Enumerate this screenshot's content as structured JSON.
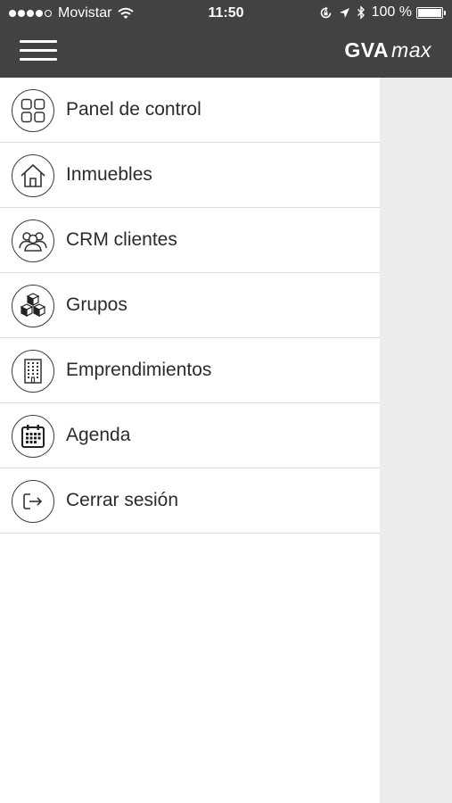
{
  "status_bar": {
    "carrier": "Movistar",
    "signal_bars_filled": 4,
    "signal_bars_total": 5,
    "time": "11:50",
    "battery_text": "100 %",
    "battery_level": 1.0,
    "icons": [
      "signal-dots-icon",
      "wifi-icon",
      "orientation-lock-icon",
      "location-arrow-icon",
      "bluetooth-icon",
      "battery-icon"
    ]
  },
  "header": {
    "logo_bold": "GVA",
    "logo_italic": "max",
    "menu_icon": "hamburger-menu-icon",
    "background": "#424242"
  },
  "menu": {
    "items": [
      {
        "label": "Panel de control",
        "icon": "dashboard-grid-icon"
      },
      {
        "label": "Inmuebles",
        "icon": "house-icon"
      },
      {
        "label": "CRM clientes",
        "icon": "people-group-icon"
      },
      {
        "label": "Grupos",
        "icon": "cubes-icon"
      },
      {
        "label": "Emprendimientos",
        "icon": "building-icon"
      },
      {
        "label": "Agenda",
        "icon": "calendar-icon"
      },
      {
        "label": "Cerrar sesión",
        "icon": "logout-icon"
      }
    ]
  }
}
